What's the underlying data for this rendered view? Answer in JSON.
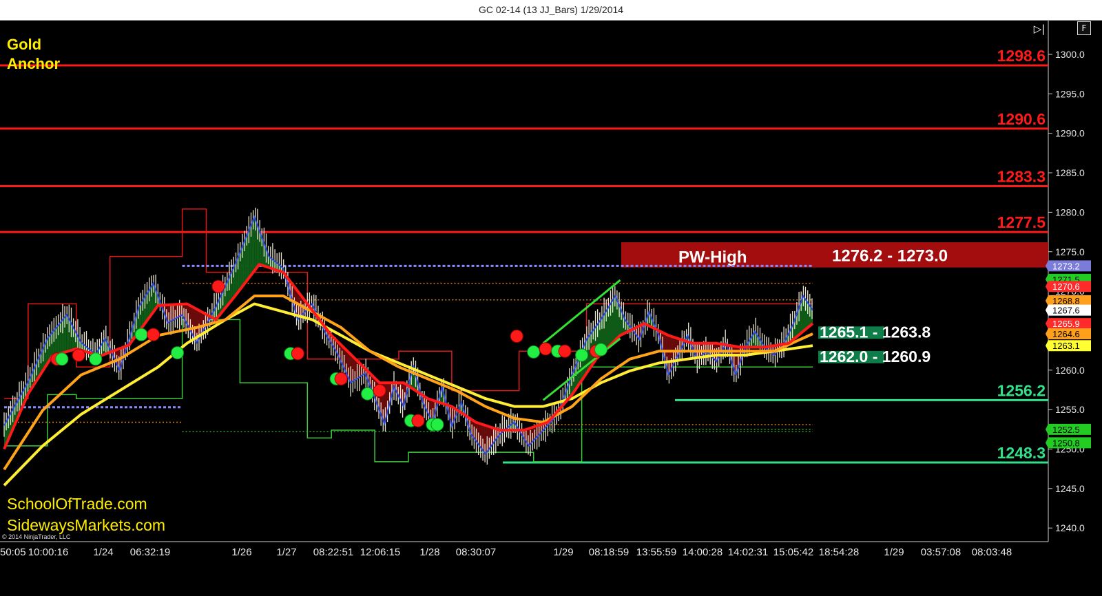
{
  "window": {
    "title": "GC 02-14 (13 JJ_Bars)  1/29/2014",
    "f_button": "F",
    "scroll_end_icon": "scroll-to-end-icon"
  },
  "overlay": {
    "heading_line1": "Gold",
    "heading_line2": "Anchor",
    "site1": "SchoolOfTrade.com",
    "site2": "SidewaysMarkets.com",
    "copyright": "© 2014 NinjaTrader, LLC"
  },
  "colors": {
    "background": "#000000",
    "resistance": "#ff1a1a",
    "support": "#33e08a",
    "pw_high_zone": "#a30d0d",
    "ema_fast": "#ff1a1a",
    "ema_mid": "#ffa31a",
    "ema_slow": "#ffee33",
    "heading": "#ffee00"
  },
  "chart_data": {
    "type": "line",
    "instrument": "GC 02-14",
    "bar_type": "13 JJ_Bars",
    "date": "1/29/2014",
    "ylim": [
      1238,
      1306
    ],
    "y_ticks": [
      1300.0,
      1295.0,
      1290.0,
      1285.0,
      1280.0,
      1275.0,
      1270.0,
      1265.0,
      1260.0,
      1255.0,
      1250.0,
      1245.0,
      1240.0
    ],
    "x_tick_labels": [
      "50:05",
      "10:00:16",
      "1/24",
      "06:32:19",
      "1/26",
      "1/27",
      "08:22:51",
      "12:06:15",
      "1/28",
      "08:30:07",
      "1/29",
      "08:18:59",
      "13:55:59",
      "14:00:28",
      "14:02:31",
      "15:05:42",
      "18:54:28",
      "1/29",
      "03:57:08",
      "08:03:48"
    ],
    "resistance_levels": [
      1298.6,
      1290.6,
      1283.3,
      1277.5
    ],
    "support_levels": [
      1256.2,
      1248.3
    ],
    "zones": [
      {
        "label": "PW-High",
        "range_text": "1276.2 - 1273.0",
        "from": 1276.2,
        "to": 1273.0
      },
      {
        "label": "",
        "range_text": "1265.1 - 1263.8",
        "from": 1265.1,
        "to": 1263.8
      },
      {
        "label": "",
        "range_text": "1262.0 - 1260.9",
        "from": 1262.0,
        "to": 1260.9
      }
    ],
    "price_markers": [
      {
        "value": 1273.2,
        "color": "#7b7bd9",
        "text": "#ffffff",
        "label": "1273.2"
      },
      {
        "value": 1271.5,
        "color": "#22cc22",
        "text": "#000000",
        "label": "1271.5"
      },
      {
        "value": 1270.6,
        "color": "#ff2a2a",
        "text": "#ffffff",
        "label": "1270.6"
      },
      {
        "value": 1268.8,
        "color": "#ff9f1a",
        "text": "#000000",
        "label": "1268.8"
      },
      {
        "value": 1267.6,
        "color": "#ffffff",
        "text": "#000000",
        "label": "1267.6"
      },
      {
        "value": 1265.9,
        "color": "#ff2a2a",
        "text": "#ffffff",
        "label": "1265.9"
      },
      {
        "value": 1264.6,
        "color": "#ff9f1a",
        "text": "#000000",
        "label": "1264.6"
      },
      {
        "value": 1263.1,
        "color": "#ffff33",
        "text": "#000000",
        "label": "1263.1"
      },
      {
        "value": 1252.5,
        "color": "#22cc22",
        "text": "#000000",
        "label": "1252.5"
      },
      {
        "value": 1250.8,
        "color": "#22cc22",
        "text": "#000000",
        "label": "1250.8"
      }
    ],
    "price_path": [
      [
        0,
        1253
      ],
      [
        5,
        1258.5
      ],
      [
        9,
        1264
      ],
      [
        13,
        1267
      ],
      [
        16,
        1263.5
      ],
      [
        19,
        1262
      ],
      [
        21,
        1264
      ],
      [
        24,
        1260
      ],
      [
        28,
        1268
      ],
      [
        31,
        1271
      ],
      [
        34,
        1266
      ],
      [
        37,
        1267
      ],
      [
        40,
        1263.5
      ],
      [
        44,
        1268
      ],
      [
        48,
        1273.4
      ],
      [
        52,
        1279.4
      ],
      [
        55,
        1274.4
      ],
      [
        58,
        1272.9
      ],
      [
        61,
        1266.4
      ],
      [
        64,
        1268.4
      ],
      [
        67,
        1264.4
      ],
      [
        69,
        1262.4
      ],
      [
        72,
        1258.4
      ],
      [
        75,
        1259.6
      ],
      [
        77,
        1256.5
      ],
      [
        79,
        1253.2
      ],
      [
        81,
        1257.9
      ],
      [
        83,
        1255.4
      ],
      [
        85,
        1260.6
      ],
      [
        87,
        1255.9
      ],
      [
        89,
        1253.4
      ],
      [
        91,
        1257.9
      ],
      [
        93,
        1252.9
      ],
      [
        95,
        1255.9
      ],
      [
        97,
        1251.9
      ],
      [
        100,
        1249.4
      ],
      [
        103,
        1251.9
      ],
      [
        106,
        1253.4
      ],
      [
        109,
        1250.4
      ],
      [
        112,
        1252.4
      ],
      [
        115,
        1254.4
      ],
      [
        118,
        1259.4
      ],
      [
        121,
        1263.9
      ],
      [
        124,
        1266.4
      ],
      [
        127,
        1269.4
      ],
      [
        129,
        1266.4
      ],
      [
        132,
        1263.9
      ],
      [
        134,
        1267.4
      ],
      [
        136,
        1264.4
      ],
      [
        138,
        1259.4
      ],
      [
        140,
        1261.9
      ],
      [
        142,
        1264.4
      ],
      [
        144,
        1261.4
      ],
      [
        146,
        1262.4
      ],
      [
        148,
        1261.1
      ],
      [
        150,
        1263.4
      ],
      [
        152,
        1259.4
      ],
      [
        154,
        1262.9
      ],
      [
        156,
        1264.9
      ],
      [
        158,
        1262.9
      ],
      [
        160,
        1261.9
      ],
      [
        162,
        1263.4
      ],
      [
        164,
        1265.9
      ],
      [
        166,
        1269.4
      ],
      [
        168,
        1267.6
      ]
    ],
    "ema_fast_path": [
      [
        0,
        1250
      ],
      [
        5,
        1257
      ],
      [
        10,
        1261.8
      ],
      [
        15,
        1262.7
      ],
      [
        20,
        1261.8
      ],
      [
        26,
        1263.2
      ],
      [
        32,
        1268.2
      ],
      [
        38,
        1268.4
      ],
      [
        44,
        1266.4
      ],
      [
        48,
        1269.4
      ],
      [
        53,
        1273.4
      ],
      [
        58,
        1272.4
      ],
      [
        63,
        1268.4
      ],
      [
        68,
        1264.4
      ],
      [
        73,
        1261.4
      ],
      [
        78,
        1258.4
      ],
      [
        83,
        1258.4
      ],
      [
        88,
        1256.4
      ],
      [
        93,
        1255.4
      ],
      [
        98,
        1253.4
      ],
      [
        103,
        1252.4
      ],
      [
        108,
        1252.4
      ],
      [
        113,
        1253.4
      ],
      [
        118,
        1256.9
      ],
      [
        123,
        1261.4
      ],
      [
        128,
        1264.4
      ],
      [
        133,
        1265.9
      ],
      [
        138,
        1264.4
      ],
      [
        143,
        1263.4
      ],
      [
        148,
        1263.4
      ],
      [
        153,
        1262.9
      ],
      [
        158,
        1262.9
      ],
      [
        163,
        1263.4
      ],
      [
        168,
        1265.9
      ]
    ],
    "ema_mid_path": [
      [
        0,
        1247.4
      ],
      [
        8,
        1254.9
      ],
      [
        16,
        1259.4
      ],
      [
        24,
        1261.4
      ],
      [
        32,
        1264.4
      ],
      [
        40,
        1265.4
      ],
      [
        46,
        1266.4
      ],
      [
        52,
        1269.4
      ],
      [
        58,
        1269.4
      ],
      [
        64,
        1267.4
      ],
      [
        70,
        1265.4
      ],
      [
        76,
        1262.4
      ],
      [
        82,
        1260.4
      ],
      [
        88,
        1258.9
      ],
      [
        94,
        1257.4
      ],
      [
        100,
        1255.4
      ],
      [
        106,
        1253.9
      ],
      [
        112,
        1253.4
      ],
      [
        118,
        1255.4
      ],
      [
        124,
        1258.9
      ],
      [
        130,
        1261.4
      ],
      [
        136,
        1262.4
      ],
      [
        142,
        1262.4
      ],
      [
        148,
        1262.4
      ],
      [
        154,
        1262.4
      ],
      [
        160,
        1262.4
      ],
      [
        168,
        1264.6
      ]
    ],
    "ema_slow_path": [
      [
        0,
        1245.4
      ],
      [
        8,
        1250.4
      ],
      [
        16,
        1254.4
      ],
      [
        24,
        1257.4
      ],
      [
        32,
        1260.4
      ],
      [
        38,
        1263.4
      ],
      [
        46,
        1266.4
      ],
      [
        52,
        1268.4
      ],
      [
        58,
        1267.4
      ],
      [
        64,
        1266.4
      ],
      [
        70,
        1264.4
      ],
      [
        76,
        1262.4
      ],
      [
        82,
        1260.9
      ],
      [
        88,
        1259.4
      ],
      [
        94,
        1257.9
      ],
      [
        100,
        1256.4
      ],
      [
        106,
        1255.4
      ],
      [
        112,
        1255.4
      ],
      [
        118,
        1256.4
      ],
      [
        124,
        1258.4
      ],
      [
        130,
        1259.9
      ],
      [
        136,
        1260.9
      ],
      [
        142,
        1261.4
      ],
      [
        148,
        1261.9
      ],
      [
        154,
        1261.9
      ],
      [
        160,
        1262.4
      ],
      [
        168,
        1263.1
      ]
    ],
    "step_high": [
      [
        0,
        1256.4
      ],
      [
        5,
        1256.4
      ],
      [
        5,
        1268.4
      ],
      [
        15,
        1268.4
      ],
      [
        15,
        1260.4
      ],
      [
        22,
        1260.4
      ],
      [
        22,
        1274.4
      ],
      [
        37,
        1274.4
      ],
      [
        37,
        1280.4
      ],
      [
        42,
        1280.4
      ],
      [
        42,
        1272.4
      ],
      [
        63,
        1272.4
      ],
      [
        63,
        1261.4
      ],
      [
        82,
        1261.4
      ],
      [
        82,
        1262.4
      ],
      [
        93,
        1262.4
      ],
      [
        93,
        1257.4
      ],
      [
        107,
        1257.4
      ],
      [
        107,
        1262.4
      ],
      [
        121,
        1262.4
      ],
      [
        121,
        1268.4
      ],
      [
        168,
        1268.4
      ]
    ],
    "step_low": [
      [
        0,
        1250.4
      ],
      [
        9,
        1250.4
      ],
      [
        9,
        1256.9
      ],
      [
        15,
        1256.9
      ],
      [
        15,
        1256.4
      ],
      [
        37,
        1256.4
      ],
      [
        37,
        1266.4
      ],
      [
        43,
        1266.4
      ],
      [
        43,
        1266.4
      ],
      [
        49,
        1266.4
      ],
      [
        49,
        1258.4
      ],
      [
        63,
        1258.4
      ],
      [
        63,
        1251.4
      ],
      [
        68,
        1251.4
      ],
      [
        68,
        1252.4
      ],
      [
        77,
        1252.4
      ],
      [
        77,
        1248.4
      ],
      [
        84,
        1248.4
      ],
      [
        84,
        1249.6
      ],
      [
        110,
        1249.6
      ],
      [
        110,
        1248.4
      ],
      [
        120,
        1248.4
      ],
      [
        120,
        1260.4
      ],
      [
        168,
        1260.4
      ]
    ],
    "dotted_levels": [
      {
        "from": 0,
        "to": 37,
        "value": 1255.3,
        "color": "#8a8aff"
      },
      {
        "from": 37,
        "to": 168,
        "value": 1273.2,
        "color": "#8a8aff"
      },
      {
        "from": 0,
        "to": 37,
        "value": 1253.4,
        "color": "#d97f1a"
      },
      {
        "from": 37,
        "to": 168,
        "value": 1271.0,
        "color": "#d97f1a"
      },
      {
        "from": 63,
        "to": 168,
        "value": 1268.9,
        "color": "#d97f1a"
      },
      {
        "from": 37,
        "to": 168,
        "value": 1252.2,
        "color": "#2ea82e"
      },
      {
        "from": 110,
        "to": 168,
        "value": 1253.1,
        "color": "#d97f1a"
      },
      {
        "from": 110,
        "to": 168,
        "value": 1252.5,
        "color": "#2ea82e"
      }
    ],
    "signals": [
      {
        "x": 11,
        "y": 1261.4,
        "color": "red"
      },
      {
        "x": 12,
        "y": 1261.4,
        "color": "green"
      },
      {
        "x": 15.5,
        "y": 1261.9,
        "color": "red"
      },
      {
        "x": 19,
        "y": 1261.4,
        "color": "green"
      },
      {
        "x": 28.5,
        "y": 1264.5,
        "color": "green"
      },
      {
        "x": 31,
        "y": 1264.5,
        "color": "red"
      },
      {
        "x": 36,
        "y": 1262.2,
        "color": "green"
      },
      {
        "x": 44.5,
        "y": 1270.6,
        "color": "red"
      },
      {
        "x": 59.5,
        "y": 1262.1,
        "color": "green"
      },
      {
        "x": 61,
        "y": 1262.1,
        "color": "red"
      },
      {
        "x": 69,
        "y": 1258.9,
        "color": "green"
      },
      {
        "x": 70,
        "y": 1258.9,
        "color": "red"
      },
      {
        "x": 75.5,
        "y": 1257.0,
        "color": "green"
      },
      {
        "x": 78,
        "y": 1257.4,
        "color": "red"
      },
      {
        "x": 84.5,
        "y": 1253.6,
        "color": "green"
      },
      {
        "x": 86,
        "y": 1253.6,
        "color": "red"
      },
      {
        "x": 89,
        "y": 1253.1,
        "color": "green"
      },
      {
        "x": 90,
        "y": 1253.1,
        "color": "green"
      },
      {
        "x": 106.5,
        "y": 1264.3,
        "color": "red"
      },
      {
        "x": 110,
        "y": 1262.3,
        "color": "green"
      },
      {
        "x": 112.5,
        "y": 1262.7,
        "color": "red"
      },
      {
        "x": 115,
        "y": 1262.4,
        "color": "green"
      },
      {
        "x": 116.5,
        "y": 1262.4,
        "color": "red"
      },
      {
        "x": 120,
        "y": 1261.9,
        "color": "green"
      },
      {
        "x": 123,
        "y": 1262.4,
        "color": "red"
      },
      {
        "x": 124,
        "y": 1262.6,
        "color": "green"
      }
    ],
    "channel_lines": [
      {
        "from": [
          112,
          1256.2
        ],
        "to": [
          128,
          1264.0
        ],
        "color": "#33e033"
      },
      {
        "from": [
          112,
          1263.4
        ],
        "to": [
          128,
          1271.4
        ],
        "color": "#33e033"
      }
    ],
    "grid": false,
    "legend": "none"
  }
}
